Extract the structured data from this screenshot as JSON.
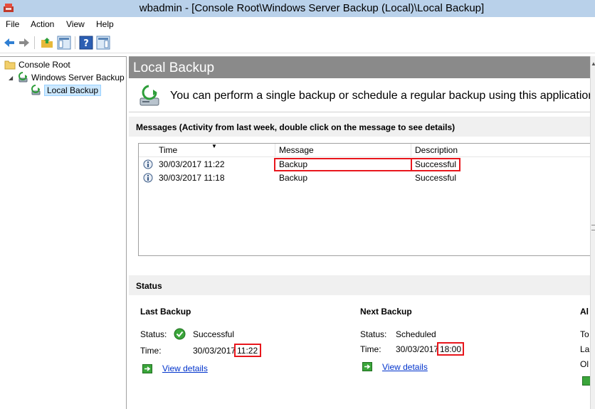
{
  "window": {
    "title": "wbadmin - [Console Root\\Windows Server Backup (Local)\\Local Backup]"
  },
  "menu": {
    "items": [
      "File",
      "Action",
      "View",
      "Help"
    ]
  },
  "tree": {
    "root": "Console Root",
    "child": "Windows Server Backup",
    "leaf": "Local Backup"
  },
  "content": {
    "header": "Local Backup",
    "intro": "You can perform a single backup or schedule a regular backup using this application.",
    "messages_title": "Messages (Activity from last week, double click on the message to see details)",
    "columns": [
      "Time",
      "Message",
      "Description"
    ],
    "rows": [
      {
        "time": "30/03/2017 11:22",
        "message": "Backup",
        "description": "Successful"
      },
      {
        "time": "30/03/2017 11:18",
        "message": "Backup",
        "description": "Successful"
      }
    ],
    "status_title": "Status",
    "last_backup": {
      "title": "Last Backup",
      "status_label": "Status:",
      "status_value": "Successful",
      "time_label": "Time:",
      "time_date": "30/03/2017",
      "time_clock": "11:22",
      "link": "View details"
    },
    "next_backup": {
      "title": "Next Backup",
      "status_label": "Status:",
      "status_value": "Scheduled",
      "time_label": "Time:",
      "time_date": "30/03/2017",
      "time_clock": "18:00",
      "link": "View details"
    },
    "third_col": {
      "title": "Al",
      "line1": "To",
      "line2": "La",
      "line3": "Ol"
    }
  },
  "colors": {
    "highlight": "#e8161c",
    "link": "#0033cc",
    "header_bg": "#8a8a8a"
  }
}
